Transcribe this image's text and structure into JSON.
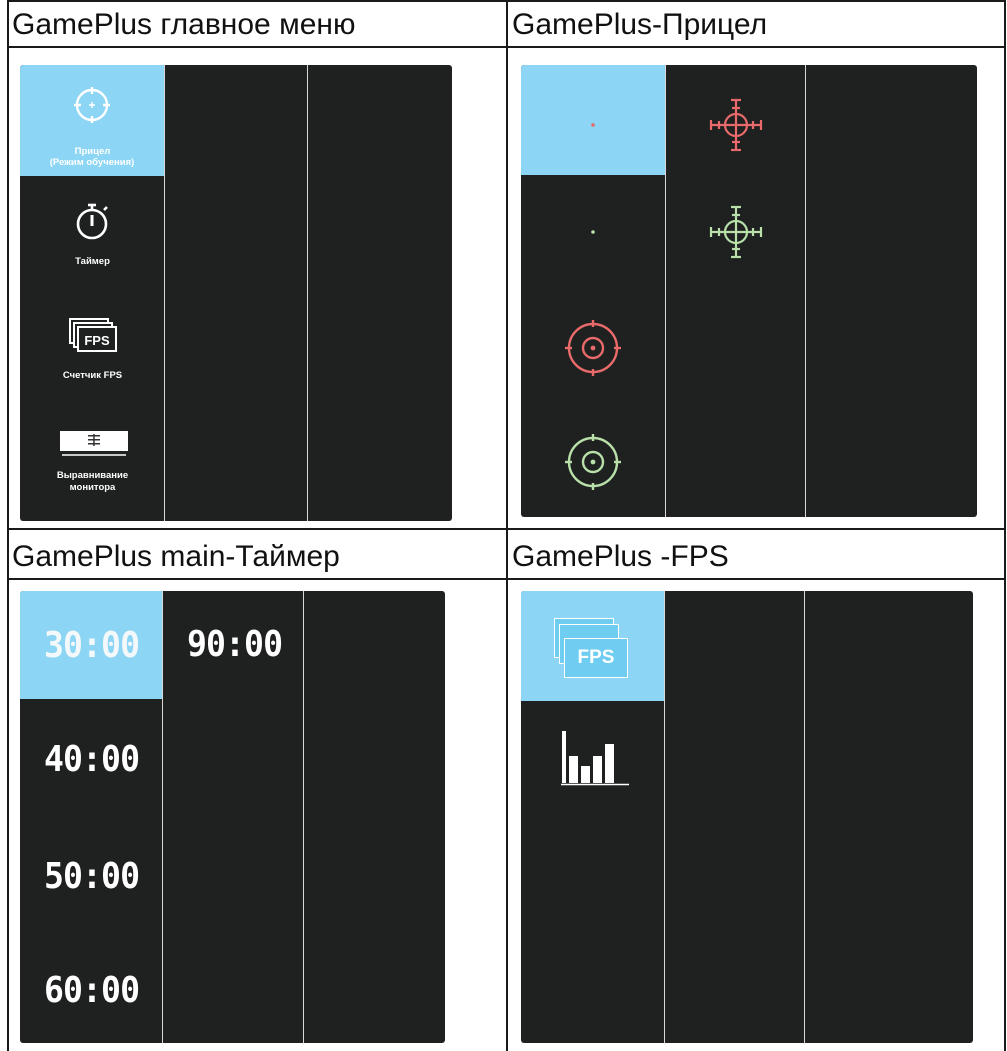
{
  "cells": {
    "main": {
      "title": "GamePlus главное меню",
      "items": [
        {
          "label_line1": "Прицел",
          "label_line2": "(Режим обучения)",
          "icon": "crosshair-icon",
          "selected": true
        },
        {
          "label_line1": "Таймер",
          "label_line2": "",
          "icon": "stopwatch-icon",
          "selected": false
        },
        {
          "label_line1": "Счетчик FPS",
          "label_line2": "",
          "icon": "fps-icon",
          "selected": false
        },
        {
          "label_line1": "Выравнивание",
          "label_line2": "монитора",
          "icon": "monitor-alignment-icon",
          "selected": false
        }
      ]
    },
    "crosshair": {
      "title": "GamePlus-Прицел",
      "options": [
        {
          "style": "dot",
          "color": "#e86a6a",
          "selected": true
        },
        {
          "style": "scope",
          "color": "#e86a6a",
          "selected": false
        },
        {
          "style": "dot",
          "color": "#b8e0a8",
          "selected": false
        },
        {
          "style": "scope",
          "color": "#b8e0a8",
          "selected": false
        },
        {
          "style": "ring",
          "color": "#e86a6a",
          "selected": false
        },
        {
          "style": "ring",
          "color": "#b8e0a8",
          "selected": false
        }
      ]
    },
    "timer": {
      "title": "GamePlus main-Таймер",
      "options": [
        "30:00",
        "40:00",
        "50:00",
        "60:00",
        "90:00"
      ],
      "selected": "30:00"
    },
    "fps": {
      "title": "GamePlus -FPS",
      "options": [
        {
          "icon": "fps-counter-icon",
          "label": "FPS",
          "selected": true
        },
        {
          "icon": "fps-bar-graph-icon",
          "selected": false
        }
      ]
    }
  }
}
